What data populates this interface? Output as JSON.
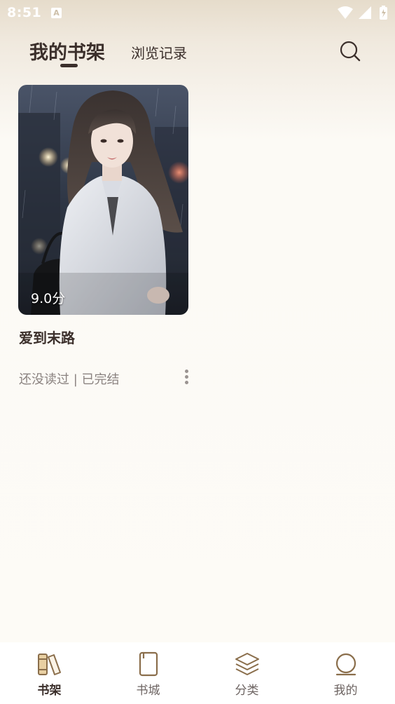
{
  "status_bar": {
    "time": "8:51",
    "notification_letter": "A"
  },
  "header": {
    "tabs": [
      {
        "label": "我的书架",
        "active": true
      },
      {
        "label": "浏览记录",
        "active": false
      }
    ],
    "search_icon": "search-icon"
  },
  "shelf": {
    "books": [
      {
        "title": "爱到末路",
        "rating": "9.0分",
        "status": "还没读过 | 已完结"
      }
    ]
  },
  "bottom_nav": {
    "items": [
      {
        "label": "书架",
        "icon": "bookshelf-icon",
        "active": true
      },
      {
        "label": "书城",
        "icon": "book-icon",
        "active": false
      },
      {
        "label": "分类",
        "icon": "layers-icon",
        "active": false
      },
      {
        "label": "我的",
        "icon": "profile-icon",
        "active": false
      }
    ]
  },
  "colors": {
    "accent": "#3b2f2b",
    "icon_brown": "#8a6e4b",
    "background": "#fdfbf6"
  }
}
